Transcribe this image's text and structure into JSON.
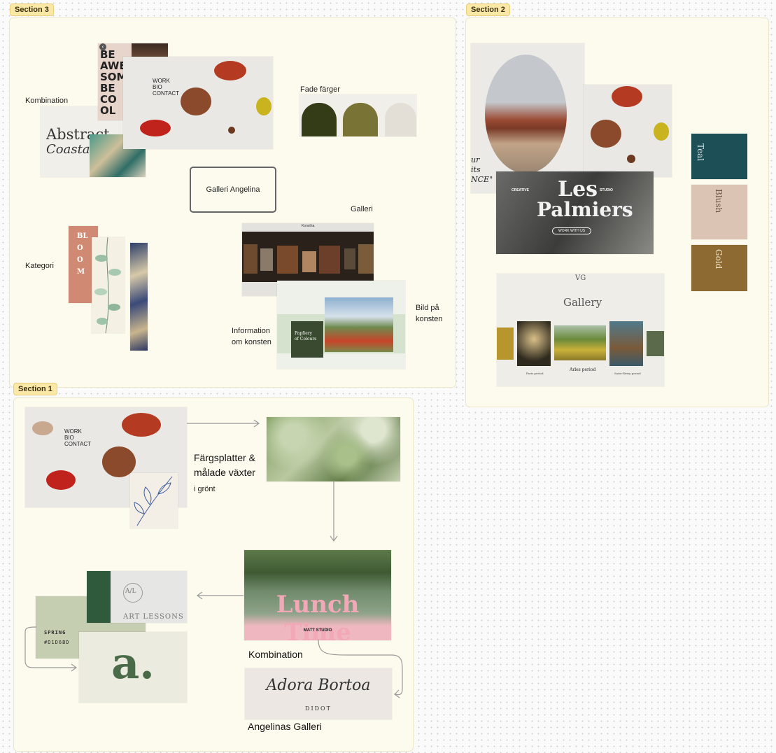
{
  "sections": {
    "s3": {
      "label": "Section 3"
    },
    "s2": {
      "label": "Section 2"
    },
    "s1": {
      "label": "Section 1"
    }
  },
  "s3": {
    "kombination": "Kombination",
    "fade": "Fade färger",
    "galleri_angelina": "Galleri Angelina",
    "galleri": "Galleri",
    "kategori": "Kategori",
    "information": "Information\nom konsten",
    "bild": "Bild på\nkonsten",
    "abstract_line1": "Abstract",
    "abstract_line2": "Coastal",
    "poster_letters": "BE\nAWE\nSOME\nBE\nCO\nOL",
    "work_menu": "WORK\nBIO\nCONTACT",
    "bloom": "BLOOM",
    "gallery_site_title": "Konstha",
    "info_card_title": "Papfiery\nof Colours",
    "fade_colors": [
      "#333b17",
      "#7a7336",
      "#e3ded6"
    ]
  },
  "s2": {
    "quote": "ur\nits\nNCE\"",
    "les": "Les",
    "palmiers": "Palmiers",
    "creative": "CREATIVE",
    "studio": "STUDIO",
    "work_with_us": "WORK WITH US",
    "gallery": "Gallery",
    "monogram": "VG",
    "periods": [
      "Paris period",
      "Arles period",
      "Saint-Rémy period"
    ],
    "swatches": [
      {
        "name": "Teal",
        "color": "#1d4f57"
      },
      {
        "name": "Blush",
        "color": "#dcc4b5"
      },
      {
        "name": "Gold",
        "color": "#8c6a32"
      }
    ]
  },
  "s1": {
    "fargplatter": "Färgsplatter &\nmålade växter",
    "i_gront": "i grönt",
    "kombination": "Kombination",
    "angelinas_galleri": "Angelinas Galleri",
    "work_menu": "WORK\nBIO\nCONTACT",
    "lunch_time": "Lunch Time",
    "matt_studio": "MATT STUDIO",
    "art_lessons": "ART LESSONS",
    "al_monogram": "A/L",
    "spring": "SPRING",
    "spring_code": "#D1D6BD",
    "a_logo": "a.",
    "signature": "Adora Bortoa",
    "didot": "DIDOT"
  }
}
